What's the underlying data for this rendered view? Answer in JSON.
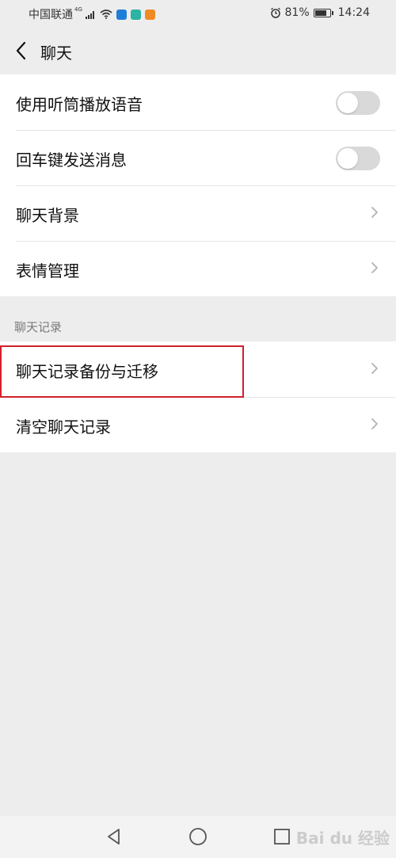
{
  "status_bar": {
    "carrier": "中国联通",
    "network": "4G",
    "battery_percent": "81%",
    "battery_level": 0.81,
    "time": "14:24",
    "icons": [
      "signal-icon",
      "wifi-icon",
      "app-blue-icon",
      "app-teal-icon",
      "app-orange-icon",
      "alarm-icon",
      "battery-icon"
    ]
  },
  "nav": {
    "title": "聊天",
    "back_icon": "chevron-left-icon"
  },
  "settings": {
    "group1": [
      {
        "label": "使用听筒播放语音",
        "type": "toggle",
        "on": false
      },
      {
        "label": "回车键发送消息",
        "type": "toggle",
        "on": false
      },
      {
        "label": "聊天背景",
        "type": "link"
      },
      {
        "label": "表情管理",
        "type": "link"
      }
    ],
    "section_header": "聊天记录",
    "group2": [
      {
        "label": "聊天记录备份与迁移",
        "type": "link",
        "highlighted": true
      },
      {
        "label": "清空聊天记录",
        "type": "link"
      }
    ]
  },
  "system_nav": {
    "back": "triangle-back-icon",
    "home": "circle-home-icon",
    "recents": "square-recents-icon"
  },
  "watermark": "Bai du 经验",
  "colors": {
    "background": "#ededed",
    "highlight": "#d0202a",
    "toggle_off": "#d9d9d9"
  }
}
